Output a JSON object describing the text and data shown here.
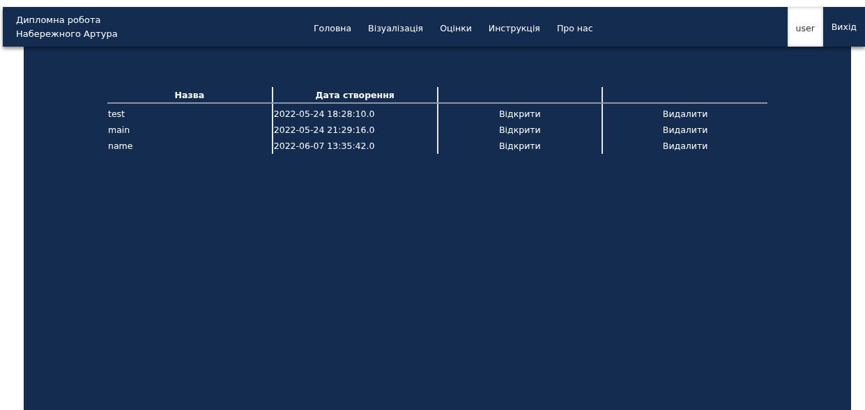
{
  "header": {
    "title_lines": [
      "Дипломна робота",
      "Набережного Артура"
    ],
    "nav": [
      {
        "label": "Головна",
        "selected": false
      },
      {
        "label": "Візуалізація",
        "selected": false
      },
      {
        "label": "Оцінки",
        "selected": false
      },
      {
        "label": "Инструкція",
        "selected": false
      },
      {
        "label": "Про нас",
        "selected": false
      }
    ],
    "account": [
      {
        "label": "user",
        "selected": true
      },
      {
        "label": "Вихід",
        "selected": false
      }
    ]
  },
  "table": {
    "columns": [
      "Назва",
      "Дата створення"
    ],
    "rows": [
      {
        "name": "test",
        "created": "2022-05-24 18:28:10.0",
        "open": "Відкрити",
        "delete": "Видалити"
      },
      {
        "name": "main",
        "created": "2022-05-24 21:29:16.0",
        "open": "Відкрити",
        "delete": "Видалити"
      },
      {
        "name": "name",
        "created": "2022-06-07 13:35:42.0",
        "open": "Відкрити",
        "delete": "Видалити"
      }
    ]
  }
}
